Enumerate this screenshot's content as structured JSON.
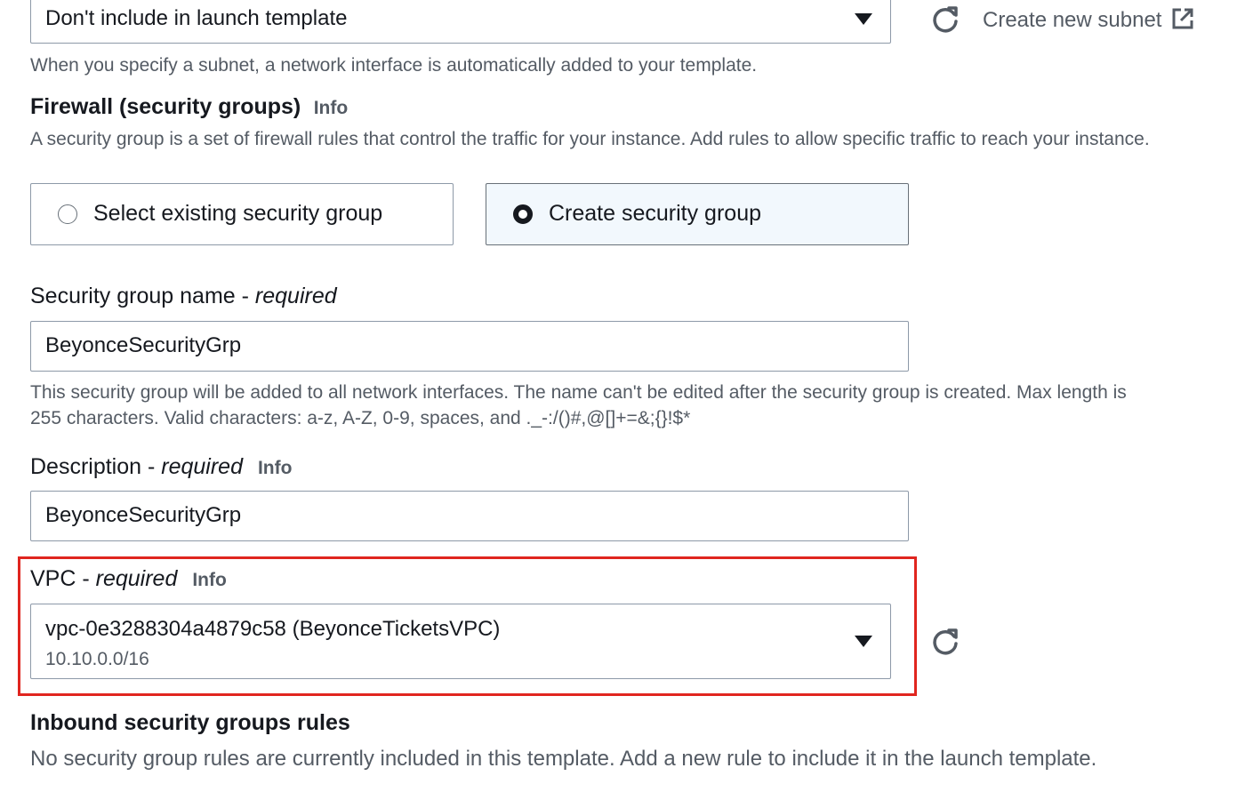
{
  "subnet": {
    "selected_value": "Don't include in launch template",
    "create_link_label": "Create new subnet",
    "help_text": "When you specify a subnet, a network interface is automatically added to your template."
  },
  "firewall": {
    "heading": "Firewall (security groups)",
    "info_label": "Info",
    "description": "A security group is a set of firewall rules that control the traffic for your instance. Add rules to allow specific traffic to reach your instance.",
    "options": [
      {
        "label": "Select existing security group",
        "selected": false
      },
      {
        "label": "Create security group",
        "selected": true
      }
    ]
  },
  "security_group_name": {
    "label": "Security group name - ",
    "required_label": "required",
    "value": "BeyonceSecurityGrp",
    "help_text_line1": "This security group will be added to all network interfaces. The name can't be edited after the security group is created. Max length is",
    "help_text_line2": "255 characters. Valid characters: a-z, A-Z, 0-9, spaces, and ._-:/()#,@[]+=&;{}!$*"
  },
  "description": {
    "label": "Description - ",
    "required_label": "required",
    "info_label": "Info",
    "value": "BeyonceSecurityGrp"
  },
  "vpc": {
    "label": "VPC - ",
    "required_label": "required",
    "info_label": "Info",
    "selected_value": "vpc-0e3288304a4879c58 (BeyonceTicketsVPC)",
    "selected_cidr": "10.10.0.0/16"
  },
  "inbound": {
    "heading": "Inbound security groups rules",
    "empty_text": "No security group rules are currently included in this template. Add a new rule to include it in the launch template."
  },
  "colors": {
    "highlight_border": "#e0251f",
    "muted_text": "#545b64",
    "selected_tile_bg": "#f2f8fd"
  }
}
